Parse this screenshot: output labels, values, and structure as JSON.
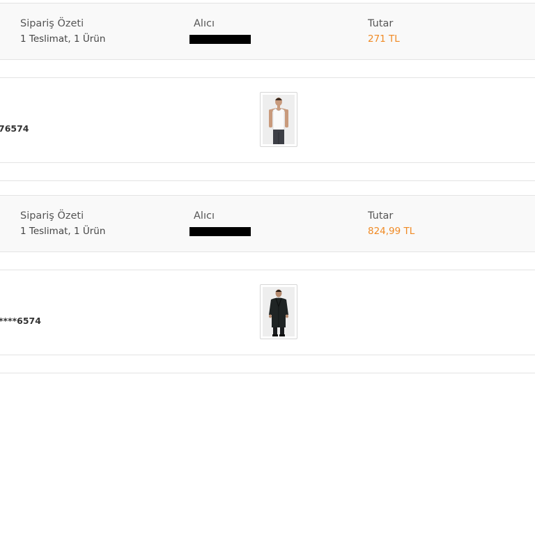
{
  "orders": [
    {
      "summary_label": "Sipariş Özeti",
      "summary_value": "1 Teslimat, 1 Ürün",
      "recipient_label": "Alıcı",
      "amount_label": "Tutar",
      "amount_value": "271 TL",
      "code": "76574",
      "product_icon": "tank-top-model-photo"
    },
    {
      "summary_label": "Sipariş Özeti",
      "summary_value": "1 Teslimat, 1 Ürün",
      "recipient_label": "Alıcı",
      "amount_label": "Tutar",
      "amount_value": "824,99 TL",
      "code": "****6574",
      "product_icon": "coat-model-photo"
    }
  ],
  "colors": {
    "amount": "#f08a24",
    "summary_bg": "#f9f9f9",
    "border": "#e3e3e3"
  }
}
